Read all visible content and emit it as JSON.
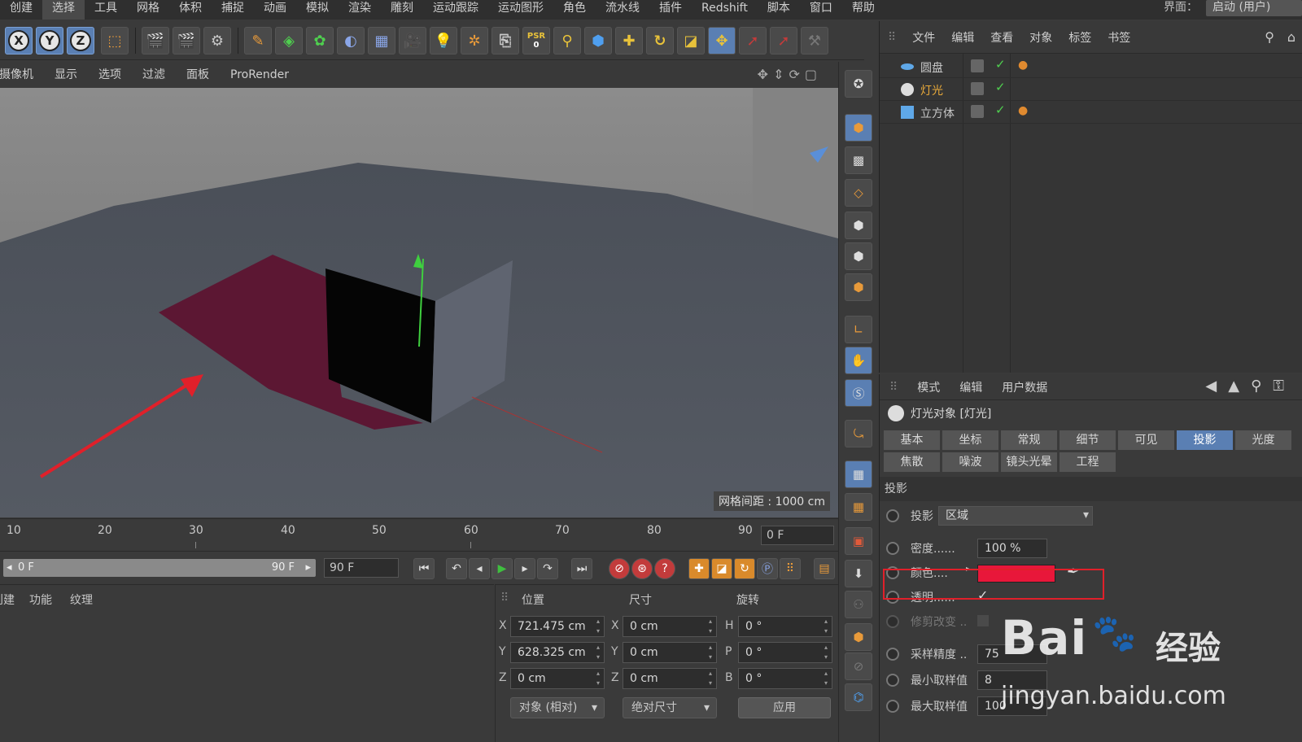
{
  "menubar": {
    "items": [
      "创建",
      "选择",
      "工具",
      "网格",
      "体积",
      "捕捉",
      "动画",
      "模拟",
      "渲染",
      "雕刻",
      "运动跟踪",
      "运动图形",
      "角色",
      "流水线",
      "插件",
      "Redshift",
      "脚本",
      "窗口",
      "帮助"
    ],
    "active_index": 1,
    "layout_label": "界面：",
    "layout_value": "启动 (用户)"
  },
  "toolbar": {
    "axis_x": "X",
    "axis_y": "Y",
    "axis_z": "Z",
    "psr_label": "PSR",
    "psr_value": "0"
  },
  "viewport_menu": {
    "items": [
      "摄像机",
      "显示",
      "选项",
      "过滤",
      "面板",
      "ProRender"
    ],
    "grid_spacing": "网格间距 : 1000 cm"
  },
  "timeline": {
    "ticks": [
      "10",
      "20",
      "30",
      "40",
      "50",
      "60",
      "70",
      "80",
      "90"
    ],
    "current_frame": "0 F",
    "range_start": "0 F",
    "range_end": "90 F",
    "end_frame": "90 F"
  },
  "material_panel": {
    "tabs": [
      "创建",
      "功能",
      "纹理"
    ]
  },
  "coordinates": {
    "headers": {
      "position": "位置",
      "size": "尺寸",
      "rotation": "旋转"
    },
    "rows": [
      {
        "axis": "X",
        "pos": "721.475 cm",
        "size_axis": "X",
        "size": "0 cm",
        "rot_axis": "H",
        "rot": "0 °"
      },
      {
        "axis": "Y",
        "pos": "628.325 cm",
        "size_axis": "Y",
        "size": "0 cm",
        "rot_axis": "P",
        "rot": "0 °"
      },
      {
        "axis": "Z",
        "pos": "0 cm",
        "size_axis": "Z",
        "size": "0 cm",
        "rot_axis": "B",
        "rot": "0 °"
      }
    ],
    "mode_dropdown": "对象 (相对)",
    "size_dropdown": "绝对尺寸",
    "apply_label": "应用"
  },
  "object_manager": {
    "menu": [
      "文件",
      "编辑",
      "查看",
      "对象",
      "标签",
      "书签"
    ],
    "objects": [
      {
        "name": "圆盘",
        "selected": false
      },
      {
        "name": "灯光",
        "selected": true
      },
      {
        "name": "立方体",
        "selected": false
      }
    ]
  },
  "attributes": {
    "menu": [
      "模式",
      "编辑",
      "用户数据"
    ],
    "title": "灯光对象 [灯光]",
    "tabs_row1": [
      "基本",
      "坐标",
      "常规",
      "细节",
      "可见",
      "投影",
      "光度"
    ],
    "tabs_row2": [
      "焦散",
      "噪波",
      "镜头光晕",
      "工程"
    ],
    "active_tab": "投影",
    "section": "投影",
    "props": {
      "shadow_label": "投影",
      "shadow_value": "区域",
      "density_label": "密度......",
      "density_value": "100 %",
      "color_label": "颜色....",
      "color_value": "#e8173a",
      "transparency_label": "透明......",
      "transparency_value": "✓",
      "clip_label": "修剪改变 ..",
      "sample_label": "采样精度 ..",
      "sample_value": "75",
      "min_label": "最小取样值",
      "min_value": "8",
      "max_label": "最大取样值",
      "max_value": "100"
    }
  },
  "watermark": {
    "brand": "Bai",
    "brand2": "经验",
    "url": "jingyan.baidu.com"
  },
  "colors": {
    "accent_blue": "#5a7fb3",
    "selected_object": "#e8a93a",
    "highlight_red": "#e0202a",
    "shadow_color": "#e8173a"
  }
}
